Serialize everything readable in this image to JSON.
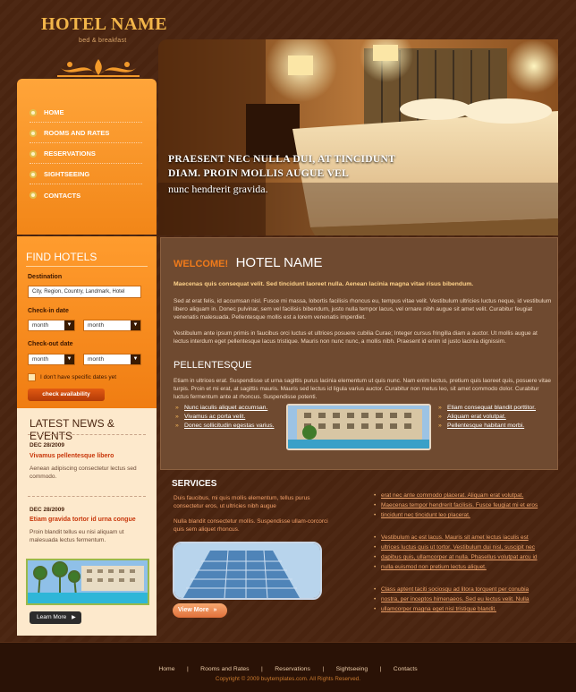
{
  "brand": {
    "title": "HOTEL NAME",
    "subtitle": "bed & breakfast"
  },
  "nav": {
    "items": [
      {
        "label": "HOME"
      },
      {
        "label": "ROOMS AND RATES"
      },
      {
        "label": "RESERVATIONS"
      },
      {
        "label": "SIGHTSEEING"
      },
      {
        "label": "CONTACTS"
      }
    ]
  },
  "hero": {
    "line1": "PRAESENT NEC NULLA DUI, AT TINCIDUNT",
    "line2": "DIAM. PROIN MOLLIS AUGUE VEL",
    "line3": "nunc hendrerit gravida."
  },
  "find_hotels": {
    "title": "FIND HOTELS",
    "destination_label": "Destination",
    "destination_value": "City, Region, Country, Landmark, Hotel",
    "checkin_label": "Check-in date",
    "checkout_label": "Check-out date",
    "month_value": "month",
    "no_dates_label": "I don't have specific dates yet",
    "check_button": "check availability"
  },
  "news": {
    "title": "LATEST NEWS & EVENTS",
    "items": [
      {
        "date": "DEC 28/2009",
        "headline": "Vivamus pellentesque libero",
        "body": "Aenean adipiscing consectetur lectus sed commodo."
      },
      {
        "date": "DEC 28/2009",
        "headline": "Etiam gravida tortor id urna congue",
        "body": "Proin blandit tellus eu nisi aliquam ut malesuada lectus fermentum."
      }
    ],
    "learn_more": "Learn More"
  },
  "welcome": {
    "small": "WELCOME!",
    "big": "HOTEL NAME",
    "lead": "Maecenas quis consequat velit. Sed tincidunt laoreet nulla. Aenean lacinia magna vitae risus bibendum.",
    "para1": "Sed at erat felis, id accumsan nisl. Fusce mi massa, lobortis facilisis rhoncus eu, tempus vitae velit. Vestibulum ultricies luctus neque, id vestibulum libero aliquam in. Donec pulvinar, sem vel facilisis bibendum, justo nulla tempor lacus, vel ornare nibh augue sit amet velit. Curabitur feugiat venenatis malesuada. Pellentesque mollis est a lorem venenatis imperdiet.",
    "para2": "Vestibulum ante ipsum primis in faucibus orci luctus et ultrices posuere cubilia Curae; Integer cursus fringilla diam a auctor. Ut mollis augue at lectus interdum eget pellentesque lacus tristique. Mauris non nunc nunc, a mollis nibh. Praesent id enim id justo lacinia dignissim.",
    "section_title": "PELLENTESQUE",
    "para3": "Etiam in ultrices erat. Suspendisse ut urna sagittis purus lacinia elementum ut quis nunc. Nam enim lectus, pretium quis laoreet quis, posuere vitae turpis. Proin et mi erat, at sagittis mauris. Mauris sed lectus id ligula varius auctor. Curabitur non metus leo, sit amet commodo dolor. Curabitur luctus fermentum ante at rhoncus. Suspendisse potenti.",
    "links_left": [
      "Nunc iaculis aliquet accumsan.",
      "Vivamus ac porta velit.",
      "Donec sollicitudin egestas varius."
    ],
    "links_right": [
      "Etiam consequat blandit porttitor.",
      "Aliquam erat volutpat.",
      "Pellentesque habitant morbi."
    ]
  },
  "services": {
    "title": "SERVICES",
    "text1": "Duis faucibus, mi quis mollis elementum, tellus purus consectetur eros, ut ultricies nibh augue",
    "text2": "Nulla blandit consectetur mollis. Suspendisse ullam-corcorci quis sem aliquet rhoncus.",
    "view_more": "View More",
    "link_groups": [
      [
        "erat nec ante commodo placerat. Aliquam erat volutpat.",
        "Maecenas tempor hendrerit facilisis. Fusce feugiat mi et eros",
        "tincidunt nec tincidunt leo placerat."
      ],
      [
        "Vestibulum ac est lacus. Mauris sit amet lectus iaculis est",
        "ultrices luctus quis ut tortor. Vestibulum dui nisl, suscipit nec",
        "dapibus quis, ullamcorper at nulla. Phasellus volutpat arcu id",
        "nulla euismod non pretium lectus aliquet."
      ],
      [
        " Class aptent taciti sociosqu ad litora torquent per conubia",
        "nostra, per inceptos himenaeos. Sed eu lectus velit. Nulla",
        "ullamcorper magna eget nisl tristique blandit."
      ]
    ]
  },
  "footer": {
    "links": [
      "Home",
      "Rooms and Rates",
      "Reservations",
      "Sightseeing",
      "Contacts"
    ],
    "copyright": "Copyright © 2009 buytemplates.com. All Rights Reserved."
  },
  "colors": {
    "accent": "#f28618",
    "background": "#4a2510",
    "panel": "#6f4a30",
    "link": "#f0a46b"
  }
}
